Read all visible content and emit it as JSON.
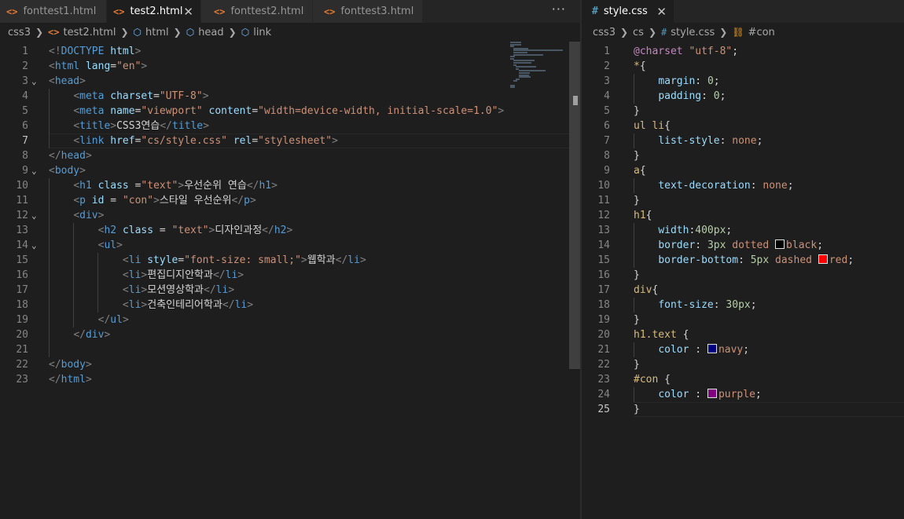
{
  "left": {
    "tabs": [
      {
        "label": "fonttest1.html",
        "icon": "html-file-icon",
        "active": false
      },
      {
        "label": "test2.html",
        "icon": "html-file-icon",
        "active": true
      },
      {
        "label": "fonttest2.html",
        "icon": "html-file-icon",
        "active": false
      },
      {
        "label": "fonttest3.html",
        "icon": "html-file-icon",
        "active": false
      }
    ],
    "more_label": "···",
    "breadcrumb": [
      "css3",
      "test2.html",
      "html",
      "head",
      "link"
    ],
    "current_line": 7
  },
  "right": {
    "tab": {
      "label": "style.css",
      "icon": "css-file-icon",
      "active": true
    },
    "breadcrumb": [
      "css3",
      "cs",
      "style.css",
      "#con"
    ],
    "current_line": 25
  },
  "glyphs": {
    "html_icon": "<>",
    "css_icon": "#",
    "close": "✕",
    "chevron": "❯",
    "fold": "⌄",
    "cube": "⬡",
    "selector": "⛓"
  },
  "colors": {
    "black": "#000000",
    "red": "#ff0000",
    "navy": "#000080",
    "purple": "#800080"
  },
  "html_lines": [
    [
      [
        "t-tag",
        "<!"
      ],
      [
        "t-tn",
        "DOCTYPE"
      ],
      [
        "t-txt",
        " "
      ],
      [
        "t-at",
        "html"
      ],
      [
        "t-tag",
        ">"
      ]
    ],
    [
      [
        "t-tag",
        "<"
      ],
      [
        "t-tn",
        "html"
      ],
      [
        "t-txt",
        " "
      ],
      [
        "t-at",
        "lang"
      ],
      [
        "t-txt",
        "="
      ],
      [
        "t-str",
        "\"en\""
      ],
      [
        "t-tag",
        ">"
      ]
    ],
    [
      [
        "t-tag",
        "<"
      ],
      [
        "t-tn",
        "head"
      ],
      [
        "t-tag",
        ">"
      ]
    ],
    [
      [
        "t-txt",
        "    "
      ],
      [
        "t-tag",
        "<"
      ],
      [
        "t-tn",
        "meta"
      ],
      [
        "t-txt",
        " "
      ],
      [
        "t-at",
        "charset"
      ],
      [
        "t-txt",
        "="
      ],
      [
        "t-str",
        "\"UTF-8\""
      ],
      [
        "t-tag",
        ">"
      ]
    ],
    [
      [
        "t-txt",
        "    "
      ],
      [
        "t-tag",
        "<"
      ],
      [
        "t-tn",
        "meta"
      ],
      [
        "t-txt",
        " "
      ],
      [
        "t-at",
        "name"
      ],
      [
        "t-txt",
        "="
      ],
      [
        "t-str",
        "\"viewport\""
      ],
      [
        "t-txt",
        " "
      ],
      [
        "t-at",
        "content"
      ],
      [
        "t-txt",
        "="
      ],
      [
        "t-str",
        "\"width=device-width, initial-scale=1.0\""
      ],
      [
        "t-tag",
        ">"
      ]
    ],
    [
      [
        "t-txt",
        "    "
      ],
      [
        "t-tag",
        "<"
      ],
      [
        "t-tn",
        "title"
      ],
      [
        "t-tag",
        ">"
      ],
      [
        "t-txt",
        "CSS3연습"
      ],
      [
        "t-tag",
        "</"
      ],
      [
        "t-tn",
        "title"
      ],
      [
        "t-tag",
        ">"
      ]
    ],
    [
      [
        "t-txt",
        "    "
      ],
      [
        "t-tag",
        "<"
      ],
      [
        "t-tn",
        "link"
      ],
      [
        "t-txt",
        " "
      ],
      [
        "t-at",
        "href"
      ],
      [
        "t-txt",
        "="
      ],
      [
        "t-str",
        "\"cs/style.css\""
      ],
      [
        "t-txt",
        " "
      ],
      [
        "t-at",
        "rel"
      ],
      [
        "t-txt",
        "="
      ],
      [
        "t-str",
        "\"stylesheet\""
      ],
      [
        "t-tag",
        ">"
      ]
    ],
    [
      [
        "t-tag",
        "</"
      ],
      [
        "t-tn",
        "head"
      ],
      [
        "t-tag",
        ">"
      ]
    ],
    [
      [
        "t-tag",
        "<"
      ],
      [
        "t-tn",
        "body"
      ],
      [
        "t-tag",
        ">"
      ]
    ],
    [
      [
        "t-txt",
        "    "
      ],
      [
        "t-tag",
        "<"
      ],
      [
        "t-tn",
        "h1"
      ],
      [
        "t-txt",
        " "
      ],
      [
        "t-at",
        "class"
      ],
      [
        "t-txt",
        " ="
      ],
      [
        "t-str",
        "\"text\""
      ],
      [
        "t-tag",
        ">"
      ],
      [
        "t-txt",
        "우선순위 연습"
      ],
      [
        "t-tag",
        "</"
      ],
      [
        "t-tn",
        "h1"
      ],
      [
        "t-tag",
        ">"
      ]
    ],
    [
      [
        "t-txt",
        "    "
      ],
      [
        "t-tag",
        "<"
      ],
      [
        "t-tn",
        "p"
      ],
      [
        "t-txt",
        " "
      ],
      [
        "t-at",
        "id"
      ],
      [
        "t-txt",
        " = "
      ],
      [
        "t-str",
        "\"con\""
      ],
      [
        "t-tag",
        ">"
      ],
      [
        "t-txt",
        "스타일 우선순위"
      ],
      [
        "t-tag",
        "</"
      ],
      [
        "t-tn",
        "p"
      ],
      [
        "t-tag",
        ">"
      ]
    ],
    [
      [
        "t-txt",
        "    "
      ],
      [
        "t-tag",
        "<"
      ],
      [
        "t-tn",
        "div"
      ],
      [
        "t-tag",
        ">"
      ]
    ],
    [
      [
        "t-txt",
        "        "
      ],
      [
        "t-tag",
        "<"
      ],
      [
        "t-tn",
        "h2"
      ],
      [
        "t-txt",
        " "
      ],
      [
        "t-at",
        "class"
      ],
      [
        "t-txt",
        " = "
      ],
      [
        "t-str",
        "\"text\""
      ],
      [
        "t-tag",
        ">"
      ],
      [
        "t-txt",
        "디자인과정"
      ],
      [
        "t-tag",
        "</"
      ],
      [
        "t-tn",
        "h2"
      ],
      [
        "t-tag",
        ">"
      ]
    ],
    [
      [
        "t-txt",
        "        "
      ],
      [
        "t-tag",
        "<"
      ],
      [
        "t-tn",
        "ul"
      ],
      [
        "t-tag",
        ">"
      ]
    ],
    [
      [
        "t-txt",
        "            "
      ],
      [
        "t-tag",
        "<"
      ],
      [
        "t-tn",
        "li"
      ],
      [
        "t-txt",
        " "
      ],
      [
        "t-at",
        "style"
      ],
      [
        "t-txt",
        "="
      ],
      [
        "t-str",
        "\"font-size: small;\""
      ],
      [
        "t-tag",
        ">"
      ],
      [
        "t-txt",
        "웹학과"
      ],
      [
        "t-tag",
        "</"
      ],
      [
        "t-tn",
        "li"
      ],
      [
        "t-tag",
        ">"
      ]
    ],
    [
      [
        "t-txt",
        "            "
      ],
      [
        "t-tag",
        "<"
      ],
      [
        "t-tn",
        "li"
      ],
      [
        "t-tag",
        ">"
      ],
      [
        "t-txt",
        "편집디지안학과"
      ],
      [
        "t-tag",
        "</"
      ],
      [
        "t-tn",
        "li"
      ],
      [
        "t-tag",
        ">"
      ]
    ],
    [
      [
        "t-txt",
        "            "
      ],
      [
        "t-tag",
        "<"
      ],
      [
        "t-tn",
        "li"
      ],
      [
        "t-tag",
        ">"
      ],
      [
        "t-txt",
        "모션영상학과"
      ],
      [
        "t-tag",
        "</"
      ],
      [
        "t-tn",
        "li"
      ],
      [
        "t-tag",
        ">"
      ]
    ],
    [
      [
        "t-txt",
        "            "
      ],
      [
        "t-tag",
        "<"
      ],
      [
        "t-tn",
        "li"
      ],
      [
        "t-tag",
        ">"
      ],
      [
        "t-txt",
        "건축인테리어학과"
      ],
      [
        "t-tag",
        "</"
      ],
      [
        "t-tn",
        "li"
      ],
      [
        "t-tag",
        ">"
      ]
    ],
    [
      [
        "t-txt",
        "        "
      ],
      [
        "t-tag",
        "</"
      ],
      [
        "t-tn",
        "ul"
      ],
      [
        "t-tag",
        ">"
      ]
    ],
    [
      [
        "t-txt",
        "    "
      ],
      [
        "t-tag",
        "</"
      ],
      [
        "t-tn",
        "div"
      ],
      [
        "t-tag",
        ">"
      ]
    ],
    [],
    [
      [
        "t-tag",
        "</"
      ],
      [
        "t-tn",
        "body"
      ],
      [
        "t-tag",
        ">"
      ]
    ],
    [
      [
        "t-tag",
        "</"
      ],
      [
        "t-tn",
        "html"
      ],
      [
        "t-tag",
        ">"
      ]
    ]
  ],
  "css_lines": [
    [
      [
        "t-kw",
        "@charset"
      ],
      [
        "t-txt",
        " "
      ],
      [
        "t-str",
        "\"utf-8\""
      ],
      [
        "t-txt",
        ";"
      ]
    ],
    [
      [
        "t-sel",
        "*"
      ],
      [
        "t-txt",
        "{"
      ]
    ],
    [
      [
        "t-txt",
        "    "
      ],
      [
        "t-prop",
        "margin"
      ],
      [
        "t-txt",
        ": "
      ],
      [
        "t-num",
        "0"
      ],
      [
        "t-txt",
        ";"
      ]
    ],
    [
      [
        "t-txt",
        "    "
      ],
      [
        "t-prop",
        "padding"
      ],
      [
        "t-txt",
        ": "
      ],
      [
        "t-num",
        "0"
      ],
      [
        "t-txt",
        ";"
      ]
    ],
    [
      [
        "t-txt",
        "}"
      ]
    ],
    [
      [
        "t-sel",
        "ul li"
      ],
      [
        "t-txt",
        "{"
      ]
    ],
    [
      [
        "t-txt",
        "    "
      ],
      [
        "t-prop",
        "list-style"
      ],
      [
        "t-txt",
        ": "
      ],
      [
        "t-val",
        "none"
      ],
      [
        "t-txt",
        ";"
      ]
    ],
    [
      [
        "t-txt",
        "}"
      ]
    ],
    [
      [
        "t-sel",
        "a"
      ],
      [
        "t-txt",
        "{"
      ]
    ],
    [
      [
        "t-txt",
        "    "
      ],
      [
        "t-prop",
        "text-decoration"
      ],
      [
        "t-txt",
        ": "
      ],
      [
        "t-val",
        "none"
      ],
      [
        "t-txt",
        ";"
      ]
    ],
    [
      [
        "t-txt",
        "}"
      ]
    ],
    [
      [
        "t-sel",
        "h1"
      ],
      [
        "t-txt",
        "{"
      ]
    ],
    [
      [
        "t-txt",
        "    "
      ],
      [
        "t-prop",
        "width"
      ],
      [
        "t-txt",
        ":"
      ],
      [
        "t-num",
        "400px"
      ],
      [
        "t-txt",
        ";"
      ]
    ],
    [
      [
        "t-txt",
        "    "
      ],
      [
        "t-prop",
        "border"
      ],
      [
        "t-txt",
        ": "
      ],
      [
        "t-num",
        "3px"
      ],
      [
        "t-txt",
        " "
      ],
      [
        "t-val",
        "dotted"
      ],
      [
        "t-txt",
        " "
      ],
      [
        "swatch",
        "black"
      ],
      [
        "t-val",
        "black"
      ],
      [
        "t-txt",
        ";"
      ]
    ],
    [
      [
        "t-txt",
        "    "
      ],
      [
        "t-prop",
        "border-bottom"
      ],
      [
        "t-txt",
        ": "
      ],
      [
        "t-num",
        "5px"
      ],
      [
        "t-txt",
        " "
      ],
      [
        "t-val",
        "dashed"
      ],
      [
        "t-txt",
        " "
      ],
      [
        "swatch",
        "red"
      ],
      [
        "t-val",
        "red"
      ],
      [
        "t-txt",
        ";"
      ]
    ],
    [
      [
        "t-txt",
        "}"
      ]
    ],
    [
      [
        "t-sel",
        "div"
      ],
      [
        "t-txt",
        "{"
      ]
    ],
    [
      [
        "t-txt",
        "    "
      ],
      [
        "t-prop",
        "font-size"
      ],
      [
        "t-txt",
        ": "
      ],
      [
        "t-num",
        "30px"
      ],
      [
        "t-txt",
        ";"
      ]
    ],
    [
      [
        "t-txt",
        "}"
      ]
    ],
    [
      [
        "t-sel",
        "h1.text"
      ],
      [
        "t-txt",
        " {"
      ]
    ],
    [
      [
        "t-txt",
        "    "
      ],
      [
        "t-prop",
        "color"
      ],
      [
        "t-txt",
        " : "
      ],
      [
        "swatch",
        "navy"
      ],
      [
        "t-val",
        "navy"
      ],
      [
        "t-txt",
        ";"
      ]
    ],
    [
      [
        "t-txt",
        "}"
      ]
    ],
    [
      [
        "t-sel",
        "#con"
      ],
      [
        "t-txt",
        " {"
      ]
    ],
    [
      [
        "t-txt",
        "    "
      ],
      [
        "t-prop",
        "color"
      ],
      [
        "t-txt",
        " : "
      ],
      [
        "swatch",
        "purple"
      ],
      [
        "t-val",
        "purple"
      ],
      [
        "t-txt",
        ";"
      ]
    ],
    [
      [
        "t-txt",
        "}"
      ]
    ]
  ]
}
